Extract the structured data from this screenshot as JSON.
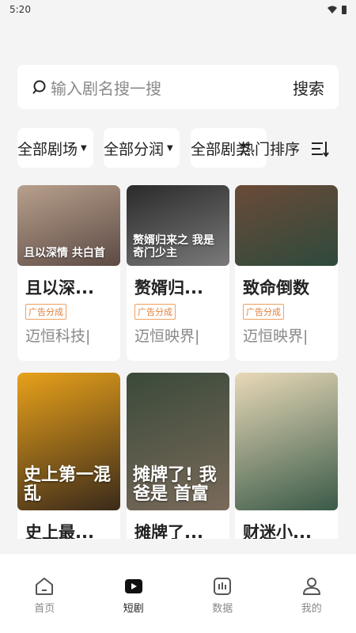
{
  "status": {
    "time": "5:20"
  },
  "search": {
    "placeholder": "输入剧名搜一搜",
    "button": "搜索"
  },
  "filters": {
    "theater": "全部剧场",
    "share": "全部分润",
    "category": "全部剧类",
    "sort": "热门排序"
  },
  "cards": [
    {
      "title": "且以深...",
      "badge": "广告分成",
      "publisher": "迈恒科技|",
      "poster_text": "且以深情 共白首",
      "colors": [
        "#b8a08c",
        "#5c4a44"
      ]
    },
    {
      "title": "赘婿归...",
      "badge": "广告分成",
      "publisher": "迈恒映界|",
      "poster_text": "赘婿归来之 我是奇门少主",
      "colors": [
        "#2a2a2a",
        "#7a7a7a"
      ]
    },
    {
      "title": "致命倒数",
      "badge": "广告分成",
      "publisher": "迈恒映界|",
      "poster_text": "",
      "colors": [
        "#6b4a38",
        "#2e4a3c"
      ]
    },
    {
      "title": "史上最...",
      "badge": "",
      "publisher": "",
      "poster_text": "史上第一混乱",
      "colors": [
        "#e8a11a",
        "#3a2a1a"
      ]
    },
    {
      "title": "摊牌了...",
      "badge": "",
      "publisher": "",
      "poster_text": "摊牌了! 我爸是 首富",
      "colors": [
        "#3a4a3a",
        "#7a6a5a"
      ]
    },
    {
      "title": "财迷小...",
      "badge": "",
      "publisher": "",
      "poster_text": "",
      "colors": [
        "#e8d9b8",
        "#3a5a48"
      ]
    }
  ],
  "nav": [
    {
      "label": "首页",
      "icon": "home-icon",
      "active": false
    },
    {
      "label": "短剧",
      "icon": "play-icon",
      "active": true
    },
    {
      "label": "数据",
      "icon": "chart-icon",
      "active": false
    },
    {
      "label": "我的",
      "icon": "user-icon",
      "active": false
    }
  ]
}
